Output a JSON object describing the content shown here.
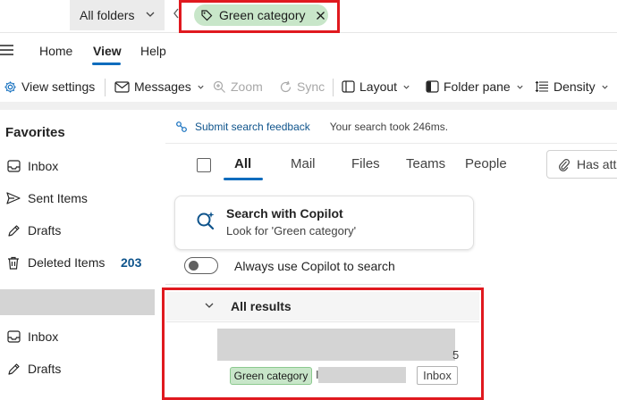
{
  "search": {
    "scope_label": "All folders",
    "filter_chip_label": "Green category"
  },
  "ribbon": {
    "tabs": [
      {
        "label": "Home",
        "selected": false
      },
      {
        "label": "View",
        "selected": true
      },
      {
        "label": "Help",
        "selected": false
      }
    ]
  },
  "toolbar": {
    "view_settings": "View settings",
    "messages": "Messages",
    "zoom": "Zoom",
    "sync": "Sync",
    "layout": "Layout",
    "folder_pane": "Folder pane",
    "density": "Density"
  },
  "sidebar": {
    "favorites_title": "Favorites",
    "favorites": [
      {
        "label": "Inbox",
        "icon": "inbox-icon"
      },
      {
        "label": "Sent Items",
        "icon": "send-icon"
      },
      {
        "label": "Drafts",
        "icon": "pencil-icon"
      },
      {
        "label": "Deleted Items",
        "icon": "trash-icon",
        "count": "203"
      }
    ],
    "account_folders": [
      {
        "label": "Inbox",
        "icon": "inbox-icon"
      },
      {
        "label": "Drafts",
        "icon": "pencil-icon"
      }
    ]
  },
  "results_pane": {
    "feedback_link": "Submit search feedback",
    "search_time": "Your search took 246ms.",
    "filter_tabs": [
      {
        "label": "All",
        "selected": true
      },
      {
        "label": "Mail",
        "selected": false
      },
      {
        "label": "Files",
        "selected": false
      },
      {
        "label": "Teams",
        "selected": false
      },
      {
        "label": "People",
        "selected": false
      }
    ],
    "attachment_filter": "Has att",
    "copilot": {
      "title": "Search with Copilot",
      "subtitle": "Look for 'Green category'",
      "toggle_label": "Always use Copilot to search",
      "toggle_on": false
    },
    "results_header": "All results",
    "result": {
      "sender_tail": "5",
      "category": "Green category",
      "subject_glyph": "I",
      "folder": "Inbox"
    }
  },
  "colors": {
    "accent": "#0f6cbd",
    "category_green": "#c8e6c9",
    "highlight_red": "#e0191f"
  }
}
